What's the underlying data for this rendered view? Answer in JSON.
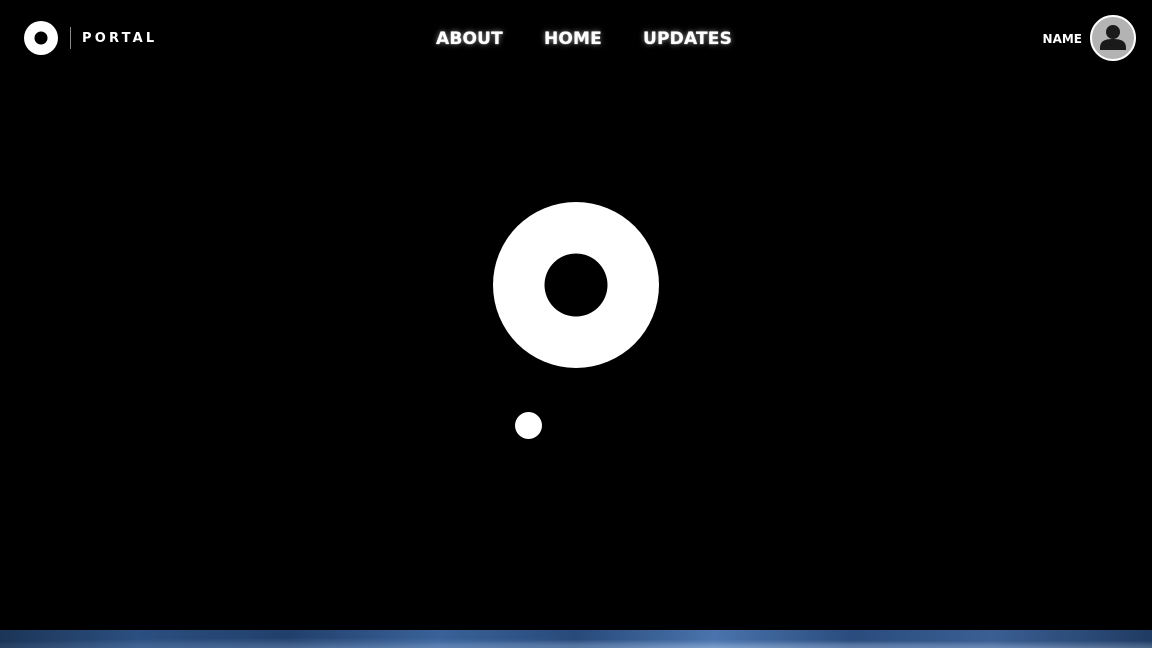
{
  "header": {
    "brand": {
      "name": "PORTAL",
      "logo_icon": "portal-ring-icon"
    },
    "nav": [
      {
        "label": "ABOUT"
      },
      {
        "label": "HOME"
      },
      {
        "label": "UPDATES"
      }
    ],
    "user": {
      "name": "NAME",
      "avatar_icon": "user-avatar-icon"
    }
  },
  "main": {
    "hero_icon": "portal-ring-icon",
    "loader_icon": "loading-dot-icon"
  },
  "colors": {
    "background": "#000000",
    "foreground": "#ffffff",
    "avatar_fill": "#b3b3b3",
    "footer_strip": "#2b4f80"
  }
}
